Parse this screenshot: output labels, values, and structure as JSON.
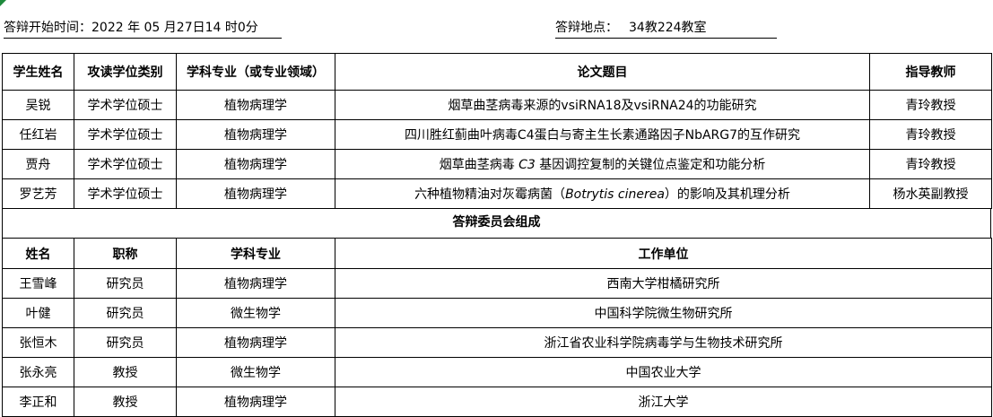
{
  "header": {
    "start_time_label": "答辩开始时间：",
    "start_time_value": "2022 年 05 月27日14 时0分",
    "location_label": "答辩地点：",
    "location_value": "34教224教室"
  },
  "students_table": {
    "columns": [
      "学生姓名",
      "攻读学位类别",
      "学科专业（或专业领域）",
      "论文题目",
      "指导教师"
    ],
    "rows": [
      {
        "name": "吴锐",
        "degree": "学术学位硕士",
        "major": "植物病理学",
        "title": "烟草曲茎病毒来源的vsiRNA18及vsiRNA24的功能研究",
        "advisor": "青玲教授"
      },
      {
        "name": "任红岩",
        "degree": "学术学位硕士",
        "major": "植物病理学",
        "title": "四川胜红蓟曲叶病毒C4蛋白与寄主生长素通路因子NbARG7的互作研究",
        "advisor": "青玲教授"
      },
      {
        "name": "贾舟",
        "degree": "学术学位硕士",
        "major": "植物病理学",
        "title_before": "烟草曲茎病毒 ",
        "title_italic": "C3",
        "title_after": " 基因调控复制的关键位点鉴定和功能分析",
        "advisor": "青玲教授"
      },
      {
        "name": "罗艺芳",
        "degree": "学术学位硕士",
        "major": "植物病理学",
        "title_before": "六种植物精油对灰霉病菌（",
        "title_italic": "Botrytis cinerea",
        "title_after": "）的影响及其机理分析",
        "advisor": "杨水英副教授"
      }
    ]
  },
  "committee": {
    "title": "答辩委员会组成",
    "columns": [
      "姓名",
      "职称",
      "学科专业",
      "工作单位"
    ],
    "rows": [
      {
        "name": "王雪峰",
        "rank": "研究员",
        "major": "植物病理学",
        "unit": "西南大学柑橘研究所"
      },
      {
        "name": "叶健",
        "rank": "研究员",
        "major": "微生物学",
        "unit": "中国科学院微生物研究所"
      },
      {
        "name": "张恒木",
        "rank": "研究员",
        "major": "植物病理学",
        "unit": "浙江省农业科学院病毒学与生物技术研究所"
      },
      {
        "name": "张永亮",
        "rank": "教授",
        "major": "微生物学",
        "unit": "中国农业大学"
      },
      {
        "name": "李正和",
        "rank": "教授",
        "major": "植物病理学",
        "unit": "浙江大学"
      }
    ]
  },
  "colors": {
    "accent_green": "#1e8a3c",
    "grid": "#000000"
  }
}
